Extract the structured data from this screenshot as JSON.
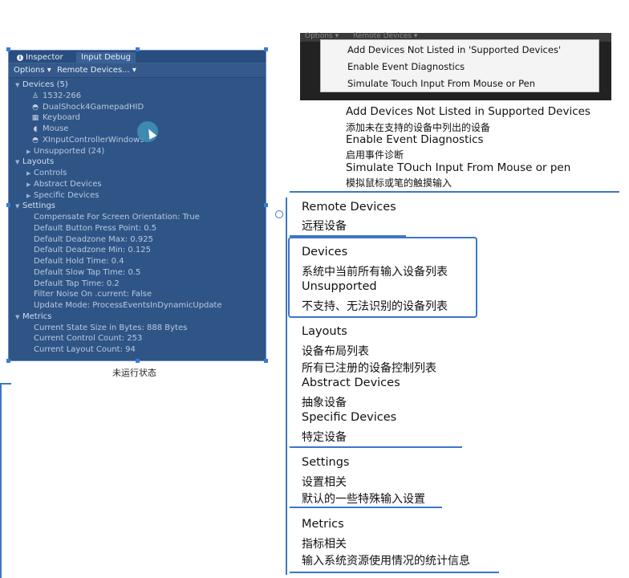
{
  "inspector": {
    "tabs": [
      "Inspector",
      "Input Debug"
    ],
    "toolbar": {
      "options": "Options ▾",
      "remote_devices": "Remote Devices... ▾"
    },
    "tree": [
      {
        "text": "Devices (5)",
        "kind": "header",
        "open": true
      },
      {
        "text": "1532-266",
        "kind": "device",
        "icon": "person-icon"
      },
      {
        "text": "DualShock4GamepadHID",
        "kind": "device",
        "icon": "gamepad-icon"
      },
      {
        "text": "Keyboard",
        "kind": "device",
        "icon": "keyboard-icon"
      },
      {
        "text": "Mouse",
        "kind": "device",
        "icon": "mouse-icon"
      },
      {
        "text": "XInputControllerWindows",
        "kind": "device",
        "icon": "gamepad-icon"
      },
      {
        "text": "Unsupported (24)",
        "kind": "sub",
        "open": false
      },
      {
        "text": "Layouts",
        "kind": "header",
        "open": true
      },
      {
        "text": "Controls",
        "kind": "sub",
        "open": false
      },
      {
        "text": "Abstract Devices",
        "kind": "sub",
        "open": false
      },
      {
        "text": "Specific Devices",
        "kind": "sub",
        "open": false
      },
      {
        "text": "Settings",
        "kind": "header",
        "open": true
      },
      {
        "text": "Compensate For Screen Orientation: True",
        "kind": "leaf"
      },
      {
        "text": "Default Button Press Point: 0.5",
        "kind": "leaf"
      },
      {
        "text": "Default Deadzone Max: 0.925",
        "kind": "leaf"
      },
      {
        "text": "Default Deadzone Min: 0.125",
        "kind": "leaf"
      },
      {
        "text": "Default Hold Time: 0.4",
        "kind": "leaf"
      },
      {
        "text": "Default Slow Tap Time: 0.5",
        "kind": "leaf"
      },
      {
        "text": "Default Tap Time: 0.2",
        "kind": "leaf"
      },
      {
        "text": "Filter Noise On .current: False",
        "kind": "leaf"
      },
      {
        "text": "Update Mode: ProcessEventsInDynamicUpdate",
        "kind": "leaf"
      },
      {
        "text": "Metrics",
        "kind": "header",
        "open": true
      },
      {
        "text": "Current State Size in Bytes: 888 Bytes",
        "kind": "leaf"
      },
      {
        "text": "Current Control Count: 253",
        "kind": "leaf"
      },
      {
        "text": "Current Layout Count: 94",
        "kind": "leaf"
      }
    ],
    "caption": "未运行状态"
  },
  "dropdown": {
    "strip": [
      "Options ▾",
      "Remote Devices ▾"
    ],
    "items": [
      "Add Devices Not Listed in 'Supported Devices'",
      "Enable Event Diagnostics",
      "Simulate Touch Input From Mouse or Pen"
    ]
  },
  "notes": [
    {
      "text": "Add Devices Not Listed in Supported Devices",
      "lang": "en"
    },
    {
      "text": "添加未在支持的设备中列出的设备",
      "lang": "cn"
    },
    {
      "text": "Enable Event Diagnostics",
      "lang": "en"
    },
    {
      "text": "启用事件诊断",
      "lang": "cn"
    },
    {
      "text": "Simulate TOuch Input From Mouse or pen",
      "lang": "en"
    },
    {
      "text": "模拟鼠标或笔的触摸输入",
      "lang": "cn"
    }
  ],
  "topics": {
    "remote": [
      "Remote Devices",
      "远程设备"
    ],
    "devices": [
      "Devices",
      "系统中当前所有输入设备列表",
      "Unsupported",
      "不支持、无法识别的设备列表"
    ],
    "layouts": [
      "Layouts",
      "设备布局列表",
      "所有已注册的设备控制列表",
      "Abstract Devices",
      "抽象设备",
      "Specific Devices",
      "特定设备"
    ],
    "settings": [
      "Settings",
      "设置相关",
      "默认的一些特殊输入设置"
    ],
    "metrics": [
      "Metrics",
      "指标相关",
      "输入系统资源使用情况的统计信息"
    ]
  },
  "colors": {
    "panel": "#2f5587",
    "accent": "#3d76c7"
  }
}
